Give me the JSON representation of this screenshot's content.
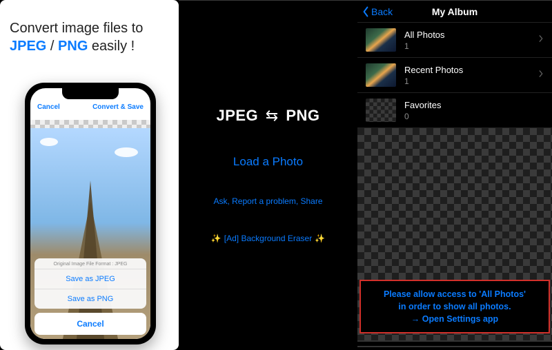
{
  "panel1": {
    "headline_pre": "Convert image files to ",
    "headline_jpeg": "JPEG",
    "headline_sep": " / ",
    "headline_png": "PNG",
    "headline_post": " easily !",
    "nav_cancel": "Cancel",
    "nav_convert": "Convert & Save",
    "sheet_title": "Original Image File Format : JPEG",
    "sheet_jpeg": "Save as JPEG",
    "sheet_png": "Save as PNG",
    "sheet_cancel": "Cancel"
  },
  "panel2": {
    "title_left": "JPEG",
    "title_arrows": "⇆",
    "title_right": "PNG",
    "load": "Load a Photo",
    "links": "Ask, Report a problem, Share",
    "ad": "[Ad] Background Eraser",
    "sparkle": "✨"
  },
  "panel3": {
    "back": "Back",
    "title": "My Album",
    "rows": [
      {
        "title": "All Photos",
        "count": "1",
        "thumb": "photo",
        "chev": true
      },
      {
        "title": "Recent Photos",
        "count": "1",
        "thumb": "photo",
        "chev": true
      },
      {
        "title": "Favorites",
        "count": "0",
        "thumb": "checker",
        "chev": false
      }
    ],
    "warning_l1": "Please allow access to 'All Photos'",
    "warning_l2": "in order to show all photos.",
    "warning_l3": "→ Open Settings app"
  },
  "colors": {
    "accent": "#0a7bff",
    "warning_border": "#d2302a"
  }
}
